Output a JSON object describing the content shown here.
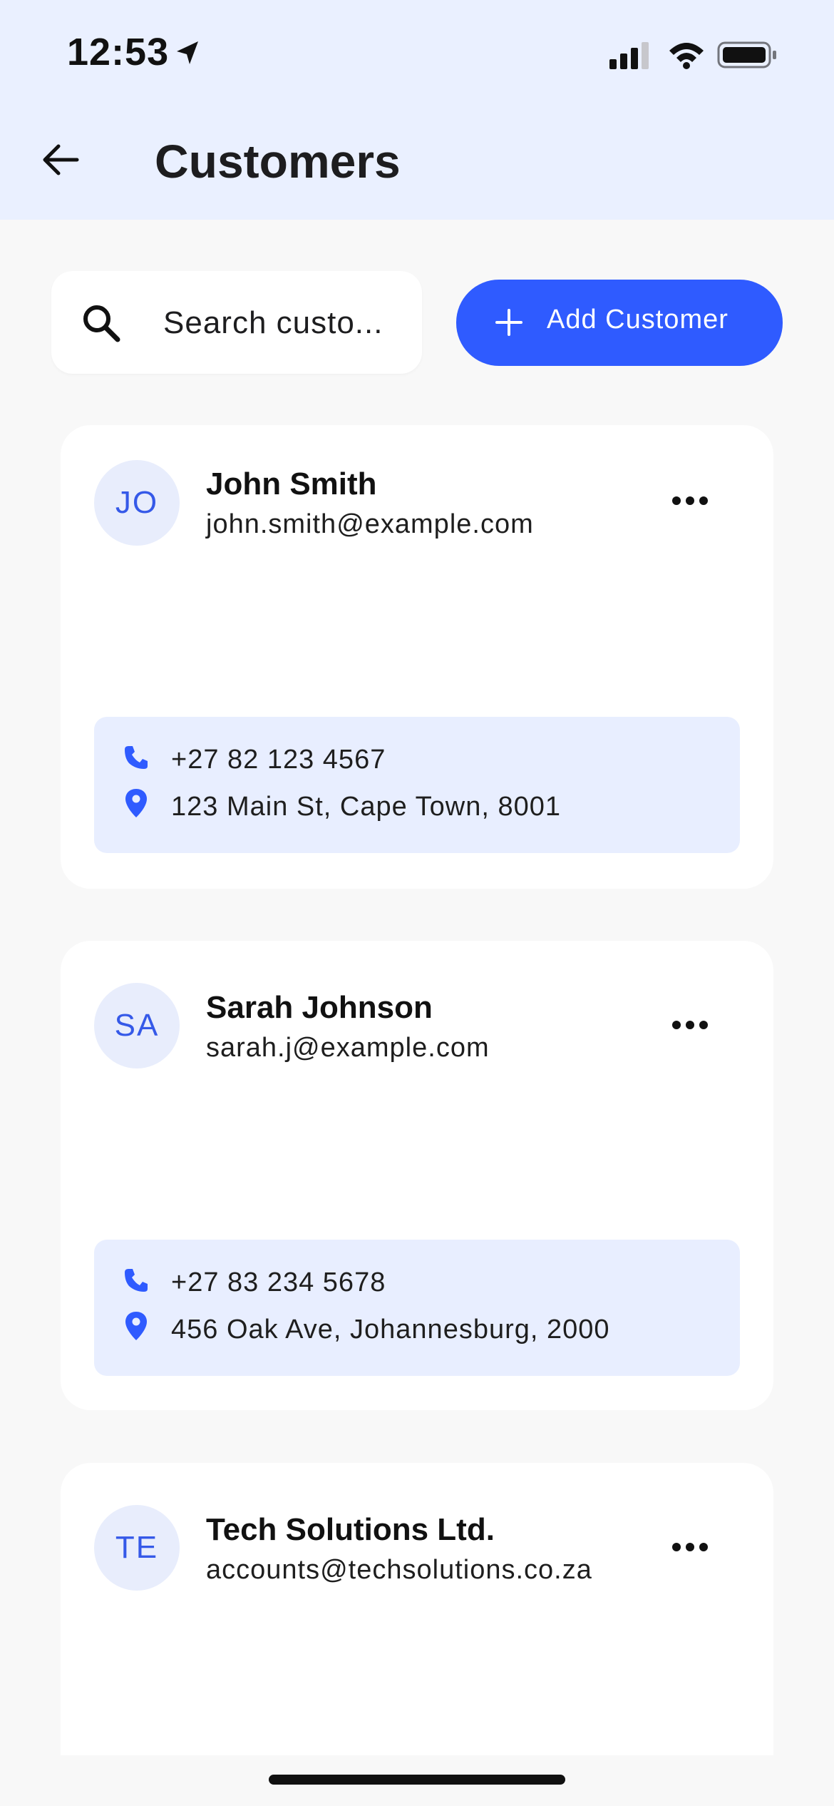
{
  "status_bar": {
    "time": "12:53"
  },
  "header": {
    "title": "Customers"
  },
  "search": {
    "placeholder": "Search custo..."
  },
  "actions": {
    "add_customer_label": "Add Customer"
  },
  "colors": {
    "accent": "#2F5BFF",
    "header_background": "#EAF0FF",
    "info_background": "#E8EEFF"
  },
  "icons": {
    "back": "back-arrow-icon",
    "search": "search-icon",
    "add": "plus-icon",
    "more": "more-icon",
    "phone": "phone-icon",
    "address": "location-pin-icon"
  },
  "customers": [
    {
      "initials": "JO",
      "name": "John Smith",
      "email": "john.smith@example.com",
      "phone": "+27 82 123 4567",
      "address": "123 Main St, Cape Town, 8001"
    },
    {
      "initials": "SA",
      "name": "Sarah Johnson",
      "email": "sarah.j@example.com",
      "phone": "+27 83 234 5678",
      "address": "456 Oak Ave, Johannesburg, 2000"
    },
    {
      "initials": "TE",
      "name": "Tech Solutions Ltd.",
      "email": "accounts@techsolutions.co.za"
    }
  ]
}
